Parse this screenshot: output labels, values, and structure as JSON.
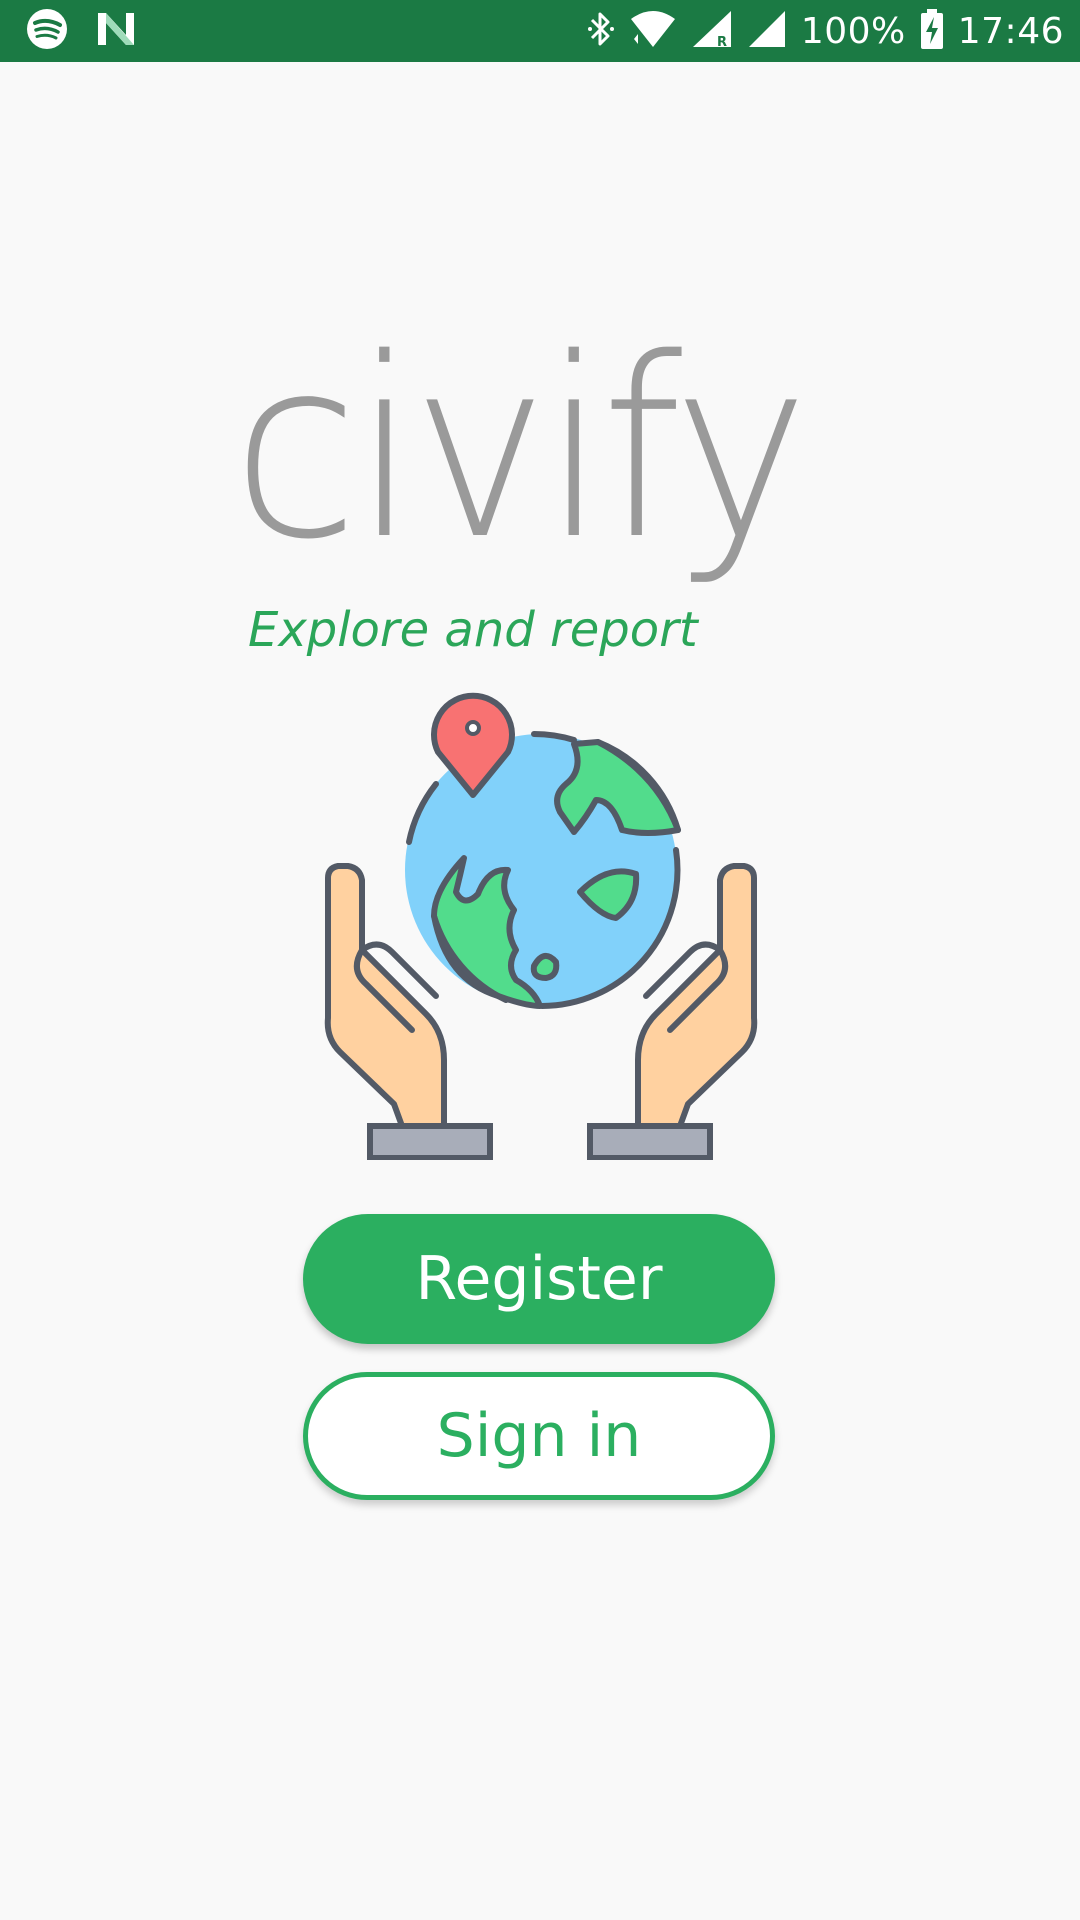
{
  "status_bar": {
    "icons_left": [
      "spotify-icon",
      "n-notification-icon"
    ],
    "icons_right": [
      "bluetooth-icon",
      "wifi-icon",
      "signal-roaming-icon",
      "signal-icon",
      "battery-charging-icon"
    ],
    "battery": "100%",
    "time": "17:46"
  },
  "brand": {
    "logo_text": "civify",
    "tagline": "Explore and report",
    "title_color": "#9a9a9a",
    "accent_color": "#2baf60"
  },
  "illustration": {
    "icon": "hands-holding-globe-with-pin-icon"
  },
  "actions": {
    "register_label": "Register",
    "signin_label": "Sign in"
  }
}
